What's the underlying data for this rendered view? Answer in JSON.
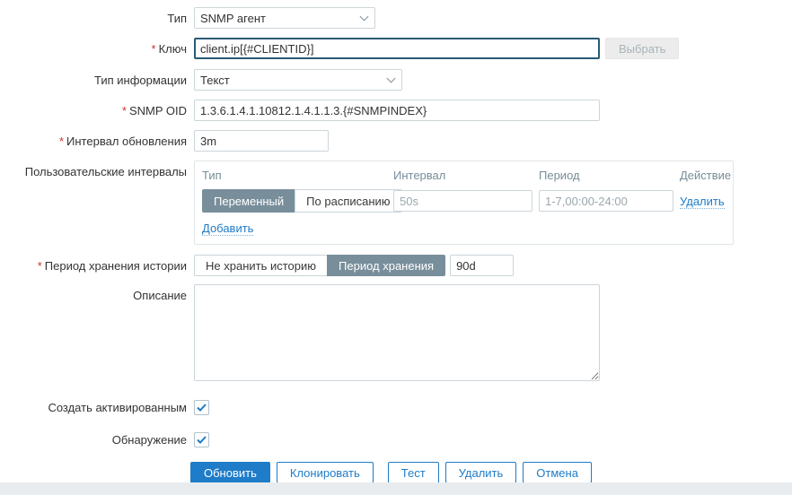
{
  "colors": {
    "accent_blue": "#1e7cc8",
    "link_blue": "#1f7bc7",
    "toggle_selected_bg": "#788e9b",
    "required_red": "#d0342c",
    "muted_input_text": "#9aa7ad",
    "focused_border": "#2a5a74",
    "footer_bar": "#e8ecef"
  },
  "form": {
    "type": {
      "label": "Тип",
      "value": "SNMP агент"
    },
    "key": {
      "label": "Ключ",
      "required_mark": "*",
      "value": "client.ip[{#CLIENTID}]",
      "select_button": "Выбрать",
      "select_button_state": "disabled"
    },
    "info_type": {
      "label": "Тип информации",
      "value": "Текст"
    },
    "snmp_oid": {
      "label": "SNMP OID",
      "required_mark": "*",
      "value": "1.3.6.1.4.1.10812.1.4.1.1.3.{#SNMPINDEX}"
    },
    "update_interval": {
      "label": "Интервал обновления",
      "required_mark": "*",
      "value": "3m"
    },
    "custom_intervals": {
      "label": "Пользовательские интервалы",
      "headers": {
        "type": "Тип",
        "interval": "Интервал",
        "period": "Период",
        "action": "Действие"
      },
      "row": {
        "type_flexible": "Переменный",
        "type_scheduled": "По расписанию",
        "selected_type": "Переменный",
        "interval_value": "50s",
        "period_value": "1-7,00:00-24:00",
        "action_label": "Удалить"
      },
      "add_label": "Добавить"
    },
    "history": {
      "label": "Период хранения истории",
      "required_mark": "*",
      "option_no_history": "Не хранить историю",
      "option_storage_period": "Период хранения",
      "selected_option": "Период хранения",
      "value": "90d"
    },
    "description": {
      "label": "Описание",
      "value": ""
    },
    "create_enabled": {
      "label": "Создать активированным",
      "checked": true
    },
    "discover": {
      "label": "Обнаружение",
      "checked": true
    },
    "buttons": {
      "update": "Обновить",
      "clone": "Клонировать",
      "test": "Тест",
      "delete": "Удалить",
      "cancel": "Отмена"
    }
  }
}
